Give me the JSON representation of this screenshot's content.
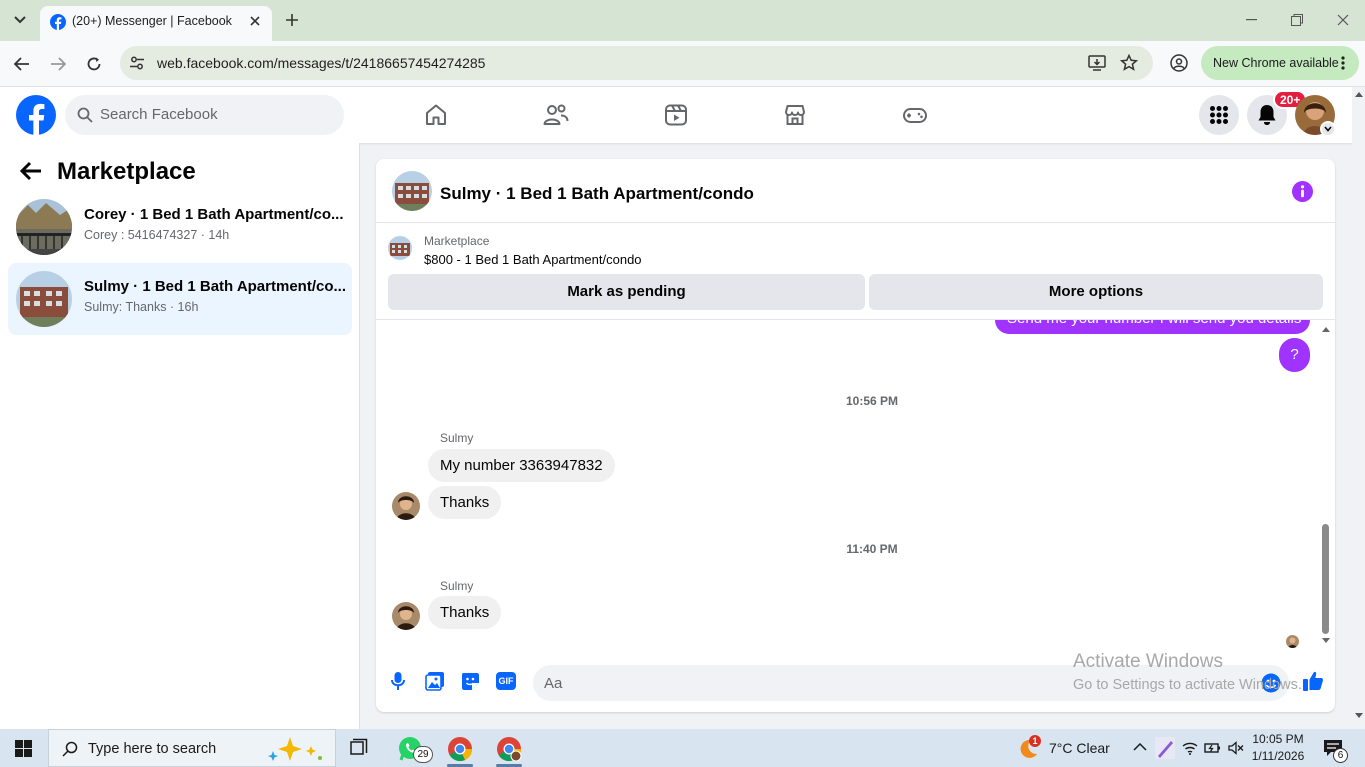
{
  "browser": {
    "tab_title": "(20+) Messenger | Facebook",
    "url": "web.facebook.com/messages/t/24186657454274285",
    "new_chrome_label": "New Chrome available"
  },
  "header": {
    "search_placeholder": "Search Facebook",
    "notification_badge": "20+"
  },
  "sidebar": {
    "title": "Marketplace",
    "conversations": [
      {
        "title": "Corey · 1 Bed 1 Bath Apartment/co...",
        "subtitle": "Corey : 5416474327 · 14h"
      },
      {
        "title": "Sulmy · 1 Bed 1 Bath Apartment/co...",
        "subtitle": "Sulmy: Thanks · 16h"
      }
    ]
  },
  "chat": {
    "title": "Sulmy · 1 Bed 1 Bath Apartment/condo",
    "listing_type": "Marketplace",
    "listing_price": "$800 - 1 Bed 1 Bath Apartment/condo",
    "mark_pending_label": "Mark as pending",
    "more_options_label": "More options",
    "messages": {
      "out_partial": "Send me your number I will send you details",
      "out_q": "?",
      "time1": "10:56 PM",
      "sender1": "Sulmy",
      "in1": "My number 3363947832",
      "in2": "Thanks",
      "time2": "11:40 PM",
      "sender2": "Sulmy",
      "in3": "Thanks"
    },
    "compose_placeholder": "Aa",
    "gif_label": "GIF"
  },
  "watermark": {
    "line1": "Activate Windows",
    "line2": "Go to Settings to activate Windows."
  },
  "taskbar": {
    "search_placeholder": "Type here to search",
    "whatsapp_badge": "29",
    "weather_badge": "1",
    "weather": "7°C  Clear",
    "time": "10:05 PM",
    "date": "1/11/2026",
    "notification_count": "6"
  },
  "colors": {
    "facebook_blue": "#0866ff",
    "messenger_purple": "#a033ff",
    "badge_red": "#e41e3f"
  }
}
